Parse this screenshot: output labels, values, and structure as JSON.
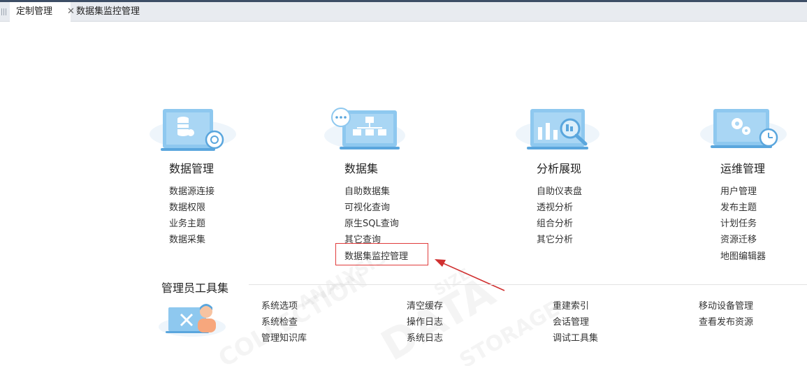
{
  "tabs": [
    {
      "label": "定制管理",
      "active": true,
      "close_icon": "close-icon"
    },
    {
      "label": "数据集监控管理",
      "active": false
    }
  ],
  "sections": [
    {
      "title": "数据管理",
      "icon": "database-settings-icon",
      "items": [
        "数据源连接",
        "数据权限",
        "业务主题",
        "数据采集"
      ]
    },
    {
      "title": "数据集",
      "icon": "dataset-tree-icon",
      "items": [
        "自助数据集",
        "可视化查询",
        "原生SQL查询",
        "其它查询",
        "数据集监控管理"
      ]
    },
    {
      "title": "分析展现",
      "icon": "analysis-chart-icon",
      "items": [
        "自助仪表盘",
        "透视分析",
        "组合分析",
        "其它分析"
      ]
    },
    {
      "title": "运维管理",
      "icon": "gears-clock-icon",
      "items": [
        "用户管理",
        "发布主题",
        "计划任务",
        "资源迁移",
        "地图编辑器"
      ]
    }
  ],
  "admin": {
    "title": "管理员工具集",
    "icon": "admin-tools-icon",
    "columns": [
      [
        "系统选项",
        "系统检查",
        "管理知识库"
      ],
      [
        "清空缓存",
        "操作日志",
        "系统日志"
      ],
      [
        "重建索引",
        "会话管理",
        "调试工具集"
      ],
      [
        "移动设备管理",
        "查看发布资源"
      ]
    ]
  },
  "highlight": {
    "target": "数据集监控管理",
    "color": "#e03c3c"
  },
  "watermark": [
    "ANALYSIS",
    "COLLECTION",
    "DATA",
    "STORAGE",
    "SIZE"
  ],
  "colors": {
    "icon_blue": "#8ec8ef",
    "icon_dark": "#5aa6dd",
    "cloud": "#eef5fb",
    "accent_red": "#e03c3c"
  }
}
